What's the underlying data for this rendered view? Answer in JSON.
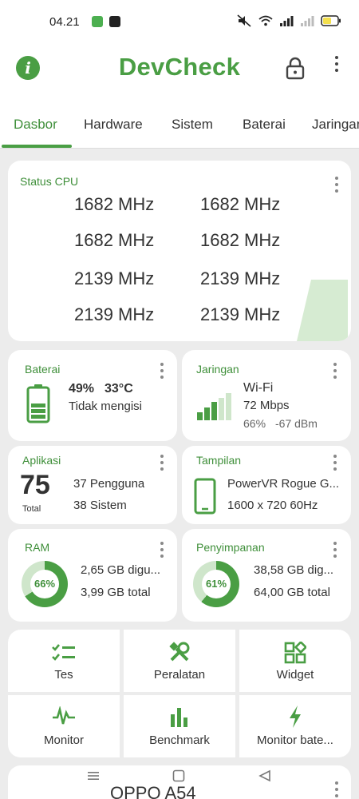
{
  "status_bar": {
    "time": "04.21",
    "colors": {
      "notif_green": "#4caf50",
      "notif_dark": "#222222",
      "battery_fill": "#f4e04d"
    }
  },
  "app_bar": {
    "title": "DevCheck",
    "info_icon": "i",
    "accent": "#4a9e44"
  },
  "tabs": [
    {
      "label": "Dasbor",
      "active": true
    },
    {
      "label": "Hardware"
    },
    {
      "label": "Sistem"
    },
    {
      "label": "Baterai"
    },
    {
      "label": "Jaringan"
    }
  ],
  "cpu": {
    "title": "Status CPU",
    "cores": [
      "1682 MHz",
      "1682 MHz",
      "1682 MHz",
      "1682 MHz",
      "2139 MHz",
      "2139 MHz",
      "2139 MHz",
      "2139 MHz"
    ]
  },
  "battery": {
    "title": "Baterai",
    "level": "49%",
    "level_fraction": 0.49,
    "temp": "33°C",
    "status": "Tidak mengisi"
  },
  "network": {
    "title": "Jaringan",
    "type": "Wi-Fi",
    "speed": "72 Mbps",
    "signal": "66%",
    "dbm": "-67 dBm"
  },
  "apps": {
    "title": "Aplikasi",
    "count": "75",
    "count_label": "Total",
    "user": "37 Pengguna",
    "system": "38 Sistem"
  },
  "display": {
    "title": "Tampilan",
    "gpu": "PowerVR Rogue G...",
    "resolution": "1600 x 720  60Hz"
  },
  "ram": {
    "title": "RAM",
    "percent": "66%",
    "fraction": 0.66,
    "used": "2,65 GB digu...",
    "total": "3,99 GB total"
  },
  "storage": {
    "title": "Penyimpanan",
    "percent": "61%",
    "fraction": 0.61,
    "used": "38,58 GB dig...",
    "total": "64,00 GB total"
  },
  "tools": [
    {
      "label": "Tes",
      "icon": "checklist-icon"
    },
    {
      "label": "Peralatan",
      "icon": "tools-icon"
    },
    {
      "label": "Widget",
      "icon": "widget-icon"
    },
    {
      "label": "Monitor",
      "icon": "pulse-icon"
    },
    {
      "label": "Benchmark",
      "icon": "bar-chart-icon"
    },
    {
      "label": "Monitor bate...",
      "icon": "lightning-icon"
    }
  ],
  "device": {
    "name": "OPPO A54"
  }
}
